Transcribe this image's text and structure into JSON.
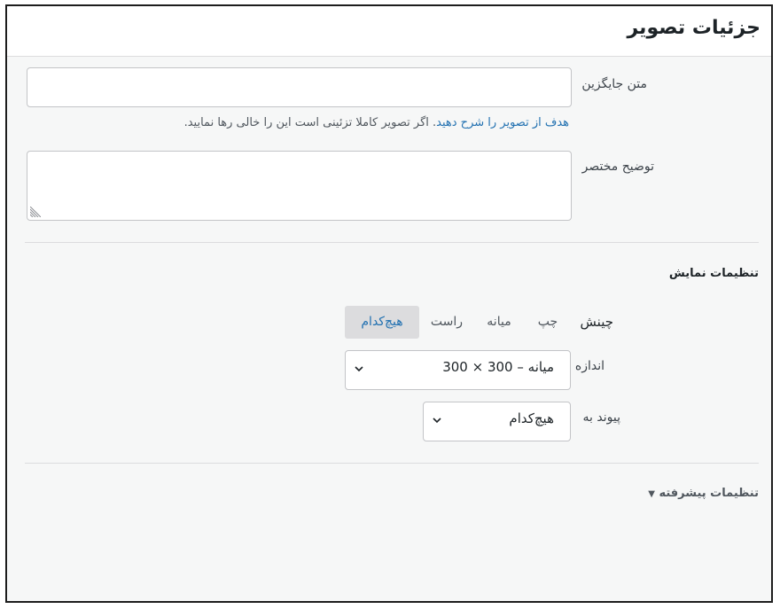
{
  "panel": {
    "title": "جزئیات تصویر"
  },
  "alt_text": {
    "label": "متن جایگزین",
    "value": "",
    "help_link": "هدف از تصویر را شرح دهید",
    "help_text": ". اگر تصویر کاملا تزئینی است این را خالی رها نمایید."
  },
  "caption": {
    "label": "توضیح مختصر",
    "value": ""
  },
  "display_settings": {
    "heading": "تنظیمات نمایش",
    "alignment": {
      "label": "چینش",
      "options": [
        "چپ",
        "میانه",
        "راست",
        "هیچ‌کدام"
      ],
      "selected": "هیچ‌کدام"
    },
    "size": {
      "label": "اندازه",
      "value": "میانه – 300 × 300"
    },
    "link_to": {
      "label": "پیوند به",
      "value": "هیچ‌کدام"
    }
  },
  "advanced": {
    "label": "تنظیمات پیشرفته",
    "arrow": "▼"
  },
  "colors": {
    "accent": "#2271b1",
    "border": "#c3c4c7",
    "background": "#f6f7f7"
  }
}
